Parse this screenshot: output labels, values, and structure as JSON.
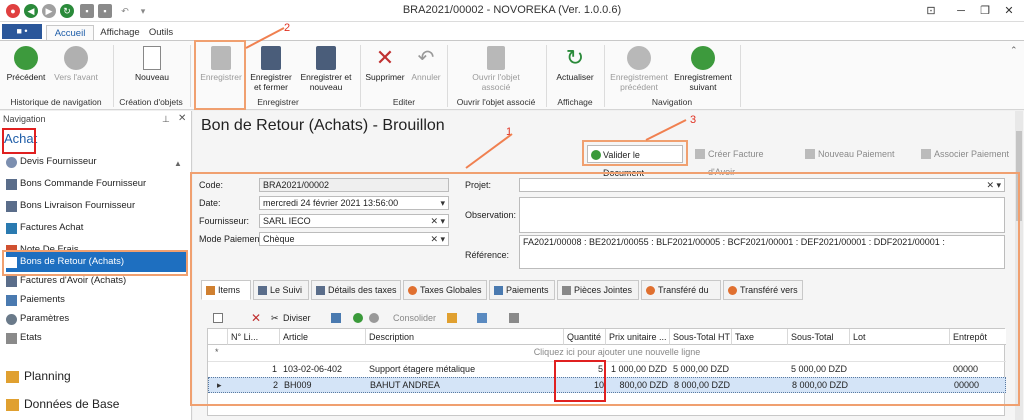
{
  "window": {
    "title": "BRA2021/00002 - NOVOREKA (Ver. 1.0.0.6)"
  },
  "ribbon_tabs": [
    "Accueil",
    "Affichage",
    "Outils"
  ],
  "file_button": "■ •",
  "ribbon": {
    "nav": {
      "prev": "Précédent",
      "next": "Vers l'avant",
      "group": "Historique de navigation"
    },
    "create": {
      "new": "Nouveau",
      "group": "Création d'objets"
    },
    "save": {
      "save": "Enregistrer",
      "save_close": "Enregistrer et fermer",
      "save_new": "Enregistrer et nouveau",
      "group": "Enregistrer"
    },
    "edit": {
      "delete": "Supprimer",
      "cancel": "Annuler",
      "group": "Editer"
    },
    "assoc": {
      "open": "Ouvrir l'objet associé",
      "group": "Ouvrir l'objet associé"
    },
    "display": {
      "refresh": "Actualiser",
      "group": "Affichage"
    },
    "navigation": {
      "prev_rec": "Enregistrement précédent",
      "next_rec": "Enregistrement suivant",
      "group": "Navigation"
    }
  },
  "navigation": {
    "header": "Navigation",
    "section": "Achat",
    "items": [
      "Devis Fournisseur",
      "Bons Commande Fournisseur",
      "Bons Livraison Fournisseur",
      "Factures Achat",
      "Note De Frais",
      "Bons de Retour (Achats)",
      "Factures d'Avoir (Achats)",
      "Paiements",
      "Paramètres",
      "Etats"
    ],
    "groups": [
      "Planning",
      "Données de Base"
    ]
  },
  "document": {
    "title": "Bon de Retour (Achats) - Brouillon",
    "actions": [
      "Valider le Document",
      "Créer Facture d'Avoir",
      "Nouveau Paiement",
      "Associer Paiement"
    ],
    "labels": {
      "code": "Code:",
      "date": "Date:",
      "supplier": "Fournisseur:",
      "payment": "Mode Paiement:",
      "project": "Projet:",
      "observation": "Observation:",
      "reference": "Référence:"
    },
    "values": {
      "code": "BRA2021/00002",
      "date": "mercredi 24 février 2021 13:56:00",
      "supplier": "SARL IECO",
      "payment": "Chèque",
      "project": "",
      "observation": "",
      "reference": "FA2021/00008 : BE2021/00055 : BLF2021/00005 : BCF2021/00001 : DEF2021/00001 : DDF2021/00001 :"
    }
  },
  "item_tabs": [
    "Items",
    "Le Suivi",
    "Détails des taxes",
    "Taxes Globales",
    "Paiements",
    "Pièces Jointes",
    "Transféré du",
    "Transféré vers"
  ],
  "grid_toolbar": {
    "split": "Diviser",
    "consolidate": "Consolider"
  },
  "grid": {
    "columns": [
      "N° Li...",
      "Article",
      "Description",
      "Quantité",
      "Prix unitaire ...",
      "Sous-Total HT",
      "Taxe",
      "Sous-Total",
      "Lot",
      "Entrepôt"
    ],
    "new_row_hint": "Cliquez ici pour ajouter une nouvelle ligne",
    "rows": [
      {
        "line": "1",
        "article": "103-02-06-402",
        "description": "Support étagere métalique",
        "qty": "5",
        "price": "1 000,00 DZD",
        "subtotal_ht": "5 000,00 DZD",
        "tax": "",
        "subtotal": "5 000,00 DZD",
        "lot": "",
        "warehouse": "00000"
      },
      {
        "line": "2",
        "article": "BH009",
        "description": "BAHUT ANDREA",
        "qty": "10",
        "price": "800,00 DZD",
        "subtotal_ht": "8 000,00 DZD",
        "tax": "",
        "subtotal": "8 000,00 DZD",
        "lot": "",
        "warehouse": "00000"
      }
    ]
  },
  "annotations": [
    "1",
    "2",
    "3"
  ]
}
